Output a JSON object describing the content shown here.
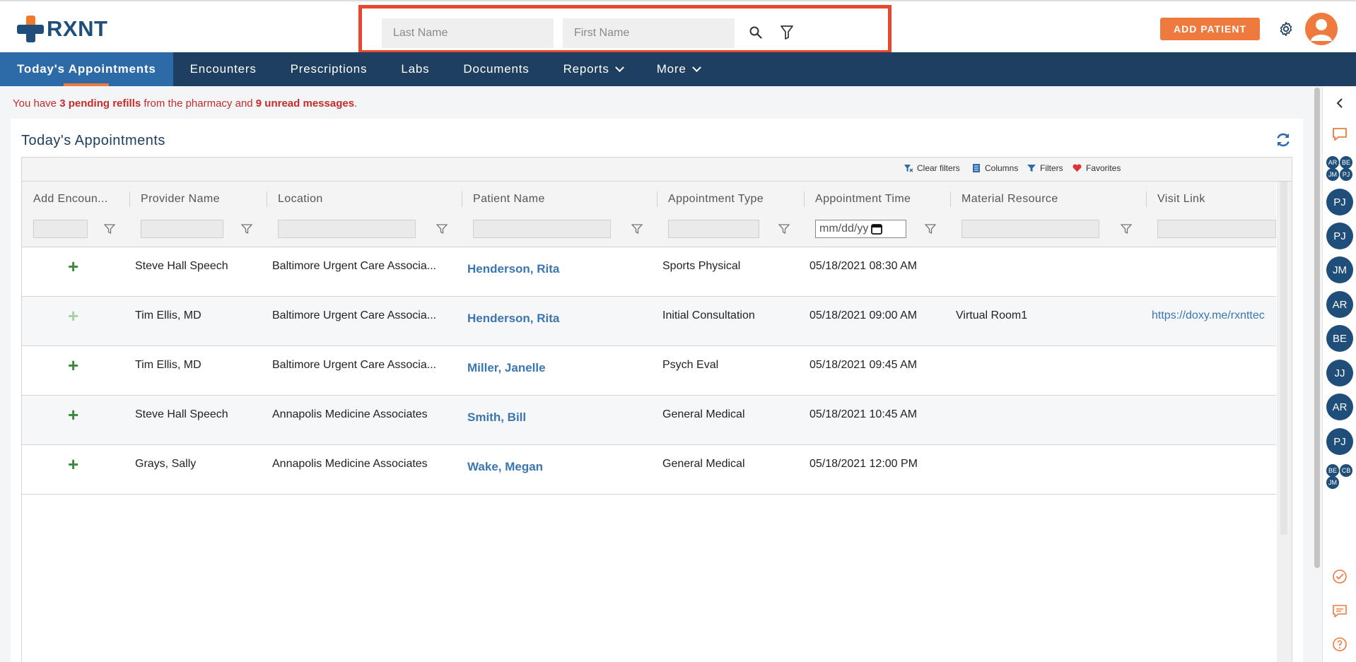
{
  "brand": {
    "name": "RXNT"
  },
  "search": {
    "last_name_placeholder": "Last Name",
    "first_name_placeholder": "First Name"
  },
  "header": {
    "add_patient_label": "ADD PATIENT"
  },
  "nav": {
    "items": [
      {
        "label": "Today's Appointments"
      },
      {
        "label": "Encounters"
      },
      {
        "label": "Prescriptions"
      },
      {
        "label": "Labs"
      },
      {
        "label": "Documents"
      },
      {
        "label": "Reports"
      },
      {
        "label": "More"
      }
    ]
  },
  "alert": {
    "prefix": "You have ",
    "refills": "3 pending refills",
    "middle": " from the pharmacy and ",
    "messages": "9 unread messages",
    "suffix": "."
  },
  "panel": {
    "title": "Today's Appointments"
  },
  "toolbar": {
    "clear_filters": "Clear filters",
    "columns": "Columns",
    "filters": "Filters",
    "favorites": "Favorites"
  },
  "table": {
    "columns": [
      "Add Encoun...",
      "Provider Name",
      "Location",
      "Patient Name",
      "Appointment Type",
      "Appointment Time",
      "Material Resource",
      "Visit Link"
    ],
    "date_placeholder": "mm/dd/yy",
    "rows": [
      {
        "add": "+",
        "provider": "Steve Hall Speech",
        "location": "Baltimore Urgent Care Associa...",
        "patient": "Henderson, Rita",
        "type": "Sports Physical",
        "time": "05/18/2021 08:30 AM",
        "resource": "",
        "link": ""
      },
      {
        "add": "+",
        "provider": "Tim Ellis, MD",
        "location": "Baltimore Urgent Care Associa...",
        "patient": "Henderson, Rita",
        "type": "Initial Consultation",
        "time": "05/18/2021 09:00 AM",
        "resource": "Virtual Room1",
        "link": "https://doxy.me/rxnttec"
      },
      {
        "add": "+",
        "provider": "Tim Ellis, MD",
        "location": "Baltimore Urgent Care Associa...",
        "patient": "Miller, Janelle",
        "type": "Psych Eval",
        "time": "05/18/2021 09:45 AM",
        "resource": "",
        "link": ""
      },
      {
        "add": "+",
        "provider": "Steve Hall Speech",
        "location": "Annapolis Medicine Associates",
        "patient": "Smith, Bill",
        "type": "General Medical",
        "time": "05/18/2021 10:45 AM",
        "resource": "",
        "link": ""
      },
      {
        "add": "+",
        "provider": "Grays, Sally",
        "location": "Annapolis Medicine Associates",
        "patient": "Wake, Megan",
        "type": "General Medical",
        "time": "05/18/2021 12:00 PM",
        "resource": "",
        "link": ""
      }
    ]
  },
  "rail": {
    "group_top": [
      "AR",
      "BE",
      "JM",
      "PJ"
    ],
    "avatars": [
      "PJ",
      "PJ",
      "JM",
      "AR",
      "BE",
      "JJ",
      "AR",
      "PJ"
    ],
    "group_bottom": [
      "BE",
      "CB",
      "JM"
    ]
  },
  "colors": {
    "nav_bg": "#1e3f60",
    "nav_active": "#2c6aa8",
    "accent": "#ef7a3d",
    "link": "#3a76b0",
    "alert": "#c62b2b",
    "highlight_border": "#e8472e"
  }
}
